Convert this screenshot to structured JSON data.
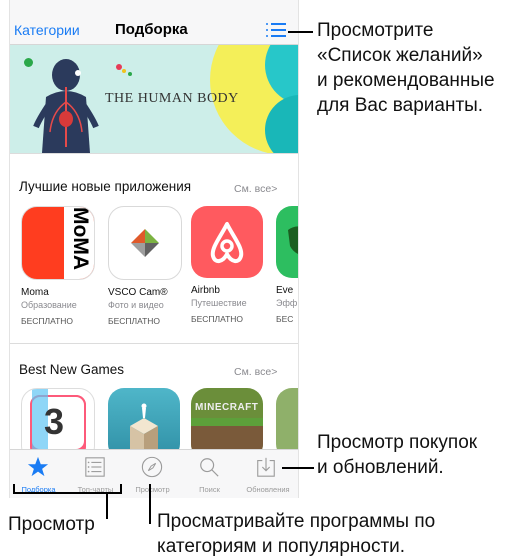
{
  "navbar": {
    "left_label": "Категории",
    "title": "Подборка"
  },
  "banner": {
    "title": "THE HUMAN BODY"
  },
  "section_apps": {
    "title": "Лучшие новые приложения",
    "see_all": "См. все",
    "items": [
      {
        "name": "Moma",
        "category": "Образование",
        "price": "БЕСПЛАТНО",
        "icon_text": "MoMA"
      },
      {
        "name": "VSCO Cam®",
        "category": "Фото и видео",
        "price": "БЕСПЛАТНО"
      },
      {
        "name": "Airbnb",
        "category": "Путешествие",
        "price": "БЕСПЛАТНО"
      },
      {
        "name": "Eve",
        "category": "Эфф",
        "price": "БЕС"
      }
    ]
  },
  "section_games": {
    "title": "Best New Games",
    "see_all": "См. все",
    "items": [
      {
        "icon_text": "3"
      },
      {
        "icon_text": ""
      },
      {
        "icon_text": "MINECRAFT"
      },
      {
        "icon_text": ""
      }
    ]
  },
  "tabbar": {
    "tabs": [
      {
        "label": "Подборка",
        "icon": "star-icon",
        "active": true
      },
      {
        "label": "Топ-чарты",
        "icon": "list-icon",
        "active": false
      },
      {
        "label": "Просмотр",
        "icon": "compass-icon",
        "active": false
      },
      {
        "label": "Поиск",
        "icon": "search-icon",
        "active": false
      },
      {
        "label": "Обновления",
        "icon": "updates-icon",
        "active": false
      }
    ]
  },
  "callouts": {
    "wishlist": [
      "Просмотрите",
      "«Список желаний»",
      "и рекомендованные",
      "для Вас варианты."
    ],
    "updates": [
      "Просмотр покупок",
      "и обновлений."
    ],
    "browse": "Просмотр",
    "categories": [
      "Просматривайте программы по",
      "категориям и популярности."
    ]
  },
  "colors": {
    "accent": "#1a7cf4",
    "moma_red": "#ff3d1f",
    "airbnb": "#ff5a5f"
  }
}
